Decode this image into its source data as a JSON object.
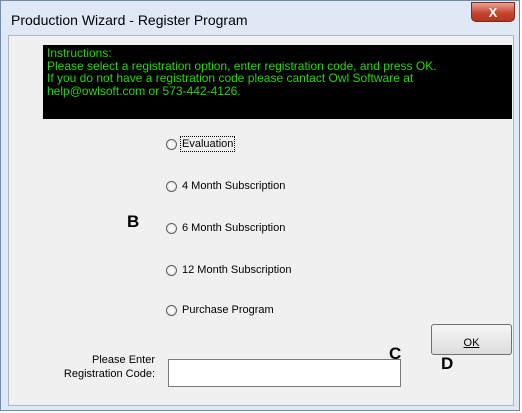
{
  "window": {
    "title": "Production Wizard - Register Program",
    "close_glyph": "X"
  },
  "instructions": {
    "lines": [
      "Instructions:",
      "Please select a registration option, enter registration code, and press OK.",
      "If you do not have a registration code please cantact Owl Software at",
      "help@owlsoft.com or 573-442-4126."
    ],
    "text_color": "#22d900",
    "background": "#000000"
  },
  "options": [
    {
      "label": "Evaluation",
      "selected": false,
      "focused": true
    },
    {
      "label": "4 Month Subscription",
      "selected": false
    },
    {
      "label": "6 Month Subscription",
      "selected": false
    },
    {
      "label": "12 Month Subscription",
      "selected": false
    },
    {
      "label": "Purchase Program",
      "selected": false
    }
  ],
  "markers": {
    "b": "B",
    "c": "C",
    "d": "D"
  },
  "registration": {
    "label_line1": "Please Enter",
    "label_line2": "Registration Code:",
    "value": ""
  },
  "ok_button": {
    "label": "OK"
  }
}
